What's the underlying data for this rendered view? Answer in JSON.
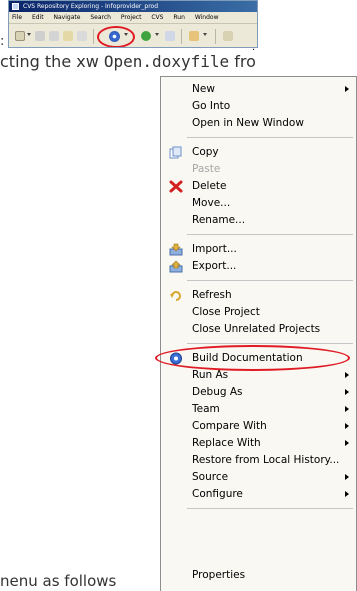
{
  "ide": {
    "window_title": "CVS Repository Exploring - Infoprovider_prod",
    "menubar": [
      "File",
      "Edit",
      "Navigate",
      "Search",
      "Project",
      "CVS",
      "Run",
      "Window"
    ]
  },
  "text": {
    "colon": ":",
    "line1_start": "cting the xw ",
    "line1_code": "Open.doxyfile",
    "line1_end": " fro",
    "line2": "nenu as follows"
  },
  "context_menu": {
    "items": {
      "new": "New",
      "go_into": "Go Into",
      "open_new_window": "Open in New Window",
      "copy": "Copy",
      "paste": "Paste",
      "delete": "Delete",
      "move": "Move...",
      "rename": "Rename...",
      "import": "Import...",
      "export": "Export...",
      "refresh": "Refresh",
      "close_project": "Close Project",
      "close_unrelated": "Close Unrelated Projects",
      "build_documentation": "Build Documentation",
      "run_as": "Run As",
      "debug_as": "Debug As",
      "team": "Team",
      "compare_with": "Compare With",
      "replace_with": "Replace With",
      "restore_history": "Restore from Local History...",
      "source": "Source",
      "configure": "Configure",
      "properties": "Properties"
    }
  },
  "colors": {
    "highlight_circle": "#e01b24",
    "menu_bg": "#f9f8f3",
    "disabled_text": "#a6a6a6"
  }
}
